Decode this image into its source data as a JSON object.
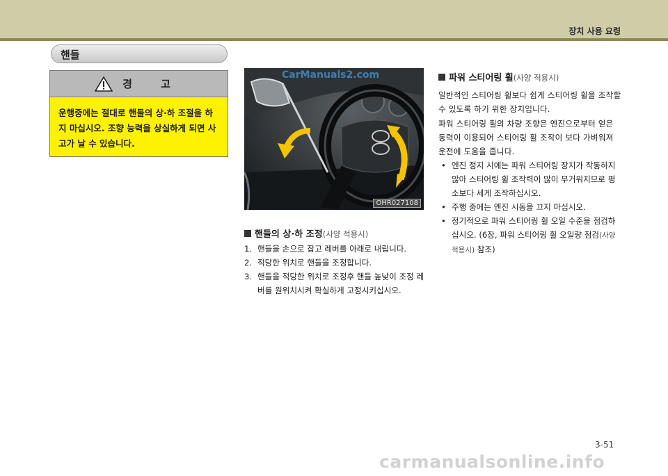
{
  "header": {
    "chapter_title": "장치 사용 요령"
  },
  "section": {
    "title": "핸들"
  },
  "warning": {
    "icon": "warning-triangle-icon",
    "title": "경 고",
    "body": "운행중에는 절대로 핸들의 상·하 조절을 하지 마십시오. 조향 능력을 상실하게 되면 사고가 날 수 있습니다."
  },
  "figure": {
    "watermark": "CarManuals2.com",
    "code": "OHR027108"
  },
  "tilt": {
    "heading": "핸들의 상·하 조정",
    "optional": "(사양 적용시)",
    "steps": [
      {
        "num": "1.",
        "text": "핸들을 손으로 잡고 레버를 아래로 내립니다."
      },
      {
        "num": "2.",
        "text": "적당한 위치로 핸들을 조정합니다."
      },
      {
        "num": "3.",
        "text": "핸들을 적당한 위치로 조정후 핸들 높낮이 조정 레버를 원위치시켜 확실하게 고정시키십시오."
      }
    ]
  },
  "power": {
    "heading": "파워 스티어링 휠",
    "optional": "(사양 적용시)",
    "para1": "일반적인 스티어링 휠보다 쉽게 스티어링 휠을 조작할 수 있도록 하기 위한 장치입니다.",
    "para2": "파워 스티어링 휠의 차량 조향은 엔진으로부터 얻은 동력이 이용되어 스티어링 휠 조작이 보다 가벼워져 운전에 도움을 줍니다.",
    "bullets": [
      "엔진 정지 시에는 파워 스티어링 장치가 작동하지 않아 스티어링 휠 조작력이 많이 무거워지므로 평소보다 세게 조작하십시오.",
      "주행 중에는 엔진 시동을 끄지 마십시오."
    ],
    "bullet3_main": "정기적으로 파워 스티어링 휠 오일 수준을 점검하십시오. (6장, 파워 스티어링 휠 오일량 점검",
    "bullet3_opt": "(사양 적용시)",
    "bullet3_end": " 참조)"
  },
  "footer": {
    "page_number": "3-51",
    "watermark": "carmanualsonline.info"
  }
}
